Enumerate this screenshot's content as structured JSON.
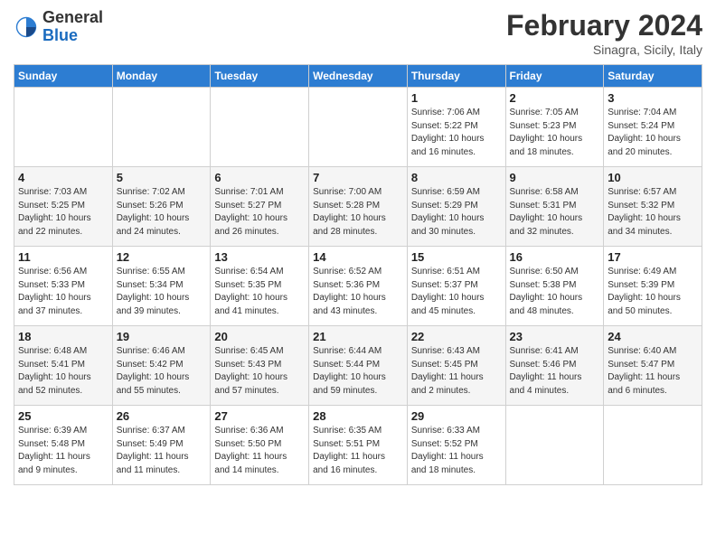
{
  "header": {
    "logo": {
      "general": "General",
      "blue": "Blue"
    },
    "title": "February 2024",
    "subtitle": "Sinagra, Sicily, Italy"
  },
  "days_of_week": [
    "Sunday",
    "Monday",
    "Tuesday",
    "Wednesday",
    "Thursday",
    "Friday",
    "Saturday"
  ],
  "weeks": [
    [
      {
        "day": "",
        "info": ""
      },
      {
        "day": "",
        "info": ""
      },
      {
        "day": "",
        "info": ""
      },
      {
        "day": "",
        "info": ""
      },
      {
        "day": "1",
        "info": "Sunrise: 7:06 AM\nSunset: 5:22 PM\nDaylight: 10 hours\nand 16 minutes."
      },
      {
        "day": "2",
        "info": "Sunrise: 7:05 AM\nSunset: 5:23 PM\nDaylight: 10 hours\nand 18 minutes."
      },
      {
        "day": "3",
        "info": "Sunrise: 7:04 AM\nSunset: 5:24 PM\nDaylight: 10 hours\nand 20 minutes."
      }
    ],
    [
      {
        "day": "4",
        "info": "Sunrise: 7:03 AM\nSunset: 5:25 PM\nDaylight: 10 hours\nand 22 minutes."
      },
      {
        "day": "5",
        "info": "Sunrise: 7:02 AM\nSunset: 5:26 PM\nDaylight: 10 hours\nand 24 minutes."
      },
      {
        "day": "6",
        "info": "Sunrise: 7:01 AM\nSunset: 5:27 PM\nDaylight: 10 hours\nand 26 minutes."
      },
      {
        "day": "7",
        "info": "Sunrise: 7:00 AM\nSunset: 5:28 PM\nDaylight: 10 hours\nand 28 minutes."
      },
      {
        "day": "8",
        "info": "Sunrise: 6:59 AM\nSunset: 5:29 PM\nDaylight: 10 hours\nand 30 minutes."
      },
      {
        "day": "9",
        "info": "Sunrise: 6:58 AM\nSunset: 5:31 PM\nDaylight: 10 hours\nand 32 minutes."
      },
      {
        "day": "10",
        "info": "Sunrise: 6:57 AM\nSunset: 5:32 PM\nDaylight: 10 hours\nand 34 minutes."
      }
    ],
    [
      {
        "day": "11",
        "info": "Sunrise: 6:56 AM\nSunset: 5:33 PM\nDaylight: 10 hours\nand 37 minutes."
      },
      {
        "day": "12",
        "info": "Sunrise: 6:55 AM\nSunset: 5:34 PM\nDaylight: 10 hours\nand 39 minutes."
      },
      {
        "day": "13",
        "info": "Sunrise: 6:54 AM\nSunset: 5:35 PM\nDaylight: 10 hours\nand 41 minutes."
      },
      {
        "day": "14",
        "info": "Sunrise: 6:52 AM\nSunset: 5:36 PM\nDaylight: 10 hours\nand 43 minutes."
      },
      {
        "day": "15",
        "info": "Sunrise: 6:51 AM\nSunset: 5:37 PM\nDaylight: 10 hours\nand 45 minutes."
      },
      {
        "day": "16",
        "info": "Sunrise: 6:50 AM\nSunset: 5:38 PM\nDaylight: 10 hours\nand 48 minutes."
      },
      {
        "day": "17",
        "info": "Sunrise: 6:49 AM\nSunset: 5:39 PM\nDaylight: 10 hours\nand 50 minutes."
      }
    ],
    [
      {
        "day": "18",
        "info": "Sunrise: 6:48 AM\nSunset: 5:41 PM\nDaylight: 10 hours\nand 52 minutes."
      },
      {
        "day": "19",
        "info": "Sunrise: 6:46 AM\nSunset: 5:42 PM\nDaylight: 10 hours\nand 55 minutes."
      },
      {
        "day": "20",
        "info": "Sunrise: 6:45 AM\nSunset: 5:43 PM\nDaylight: 10 hours\nand 57 minutes."
      },
      {
        "day": "21",
        "info": "Sunrise: 6:44 AM\nSunset: 5:44 PM\nDaylight: 10 hours\nand 59 minutes."
      },
      {
        "day": "22",
        "info": "Sunrise: 6:43 AM\nSunset: 5:45 PM\nDaylight: 11 hours\nand 2 minutes."
      },
      {
        "day": "23",
        "info": "Sunrise: 6:41 AM\nSunset: 5:46 PM\nDaylight: 11 hours\nand 4 minutes."
      },
      {
        "day": "24",
        "info": "Sunrise: 6:40 AM\nSunset: 5:47 PM\nDaylight: 11 hours\nand 6 minutes."
      }
    ],
    [
      {
        "day": "25",
        "info": "Sunrise: 6:39 AM\nSunset: 5:48 PM\nDaylight: 11 hours\nand 9 minutes."
      },
      {
        "day": "26",
        "info": "Sunrise: 6:37 AM\nSunset: 5:49 PM\nDaylight: 11 hours\nand 11 minutes."
      },
      {
        "day": "27",
        "info": "Sunrise: 6:36 AM\nSunset: 5:50 PM\nDaylight: 11 hours\nand 14 minutes."
      },
      {
        "day": "28",
        "info": "Sunrise: 6:35 AM\nSunset: 5:51 PM\nDaylight: 11 hours\nand 16 minutes."
      },
      {
        "day": "29",
        "info": "Sunrise: 6:33 AM\nSunset: 5:52 PM\nDaylight: 11 hours\nand 18 minutes."
      },
      {
        "day": "",
        "info": ""
      },
      {
        "day": "",
        "info": ""
      }
    ]
  ]
}
